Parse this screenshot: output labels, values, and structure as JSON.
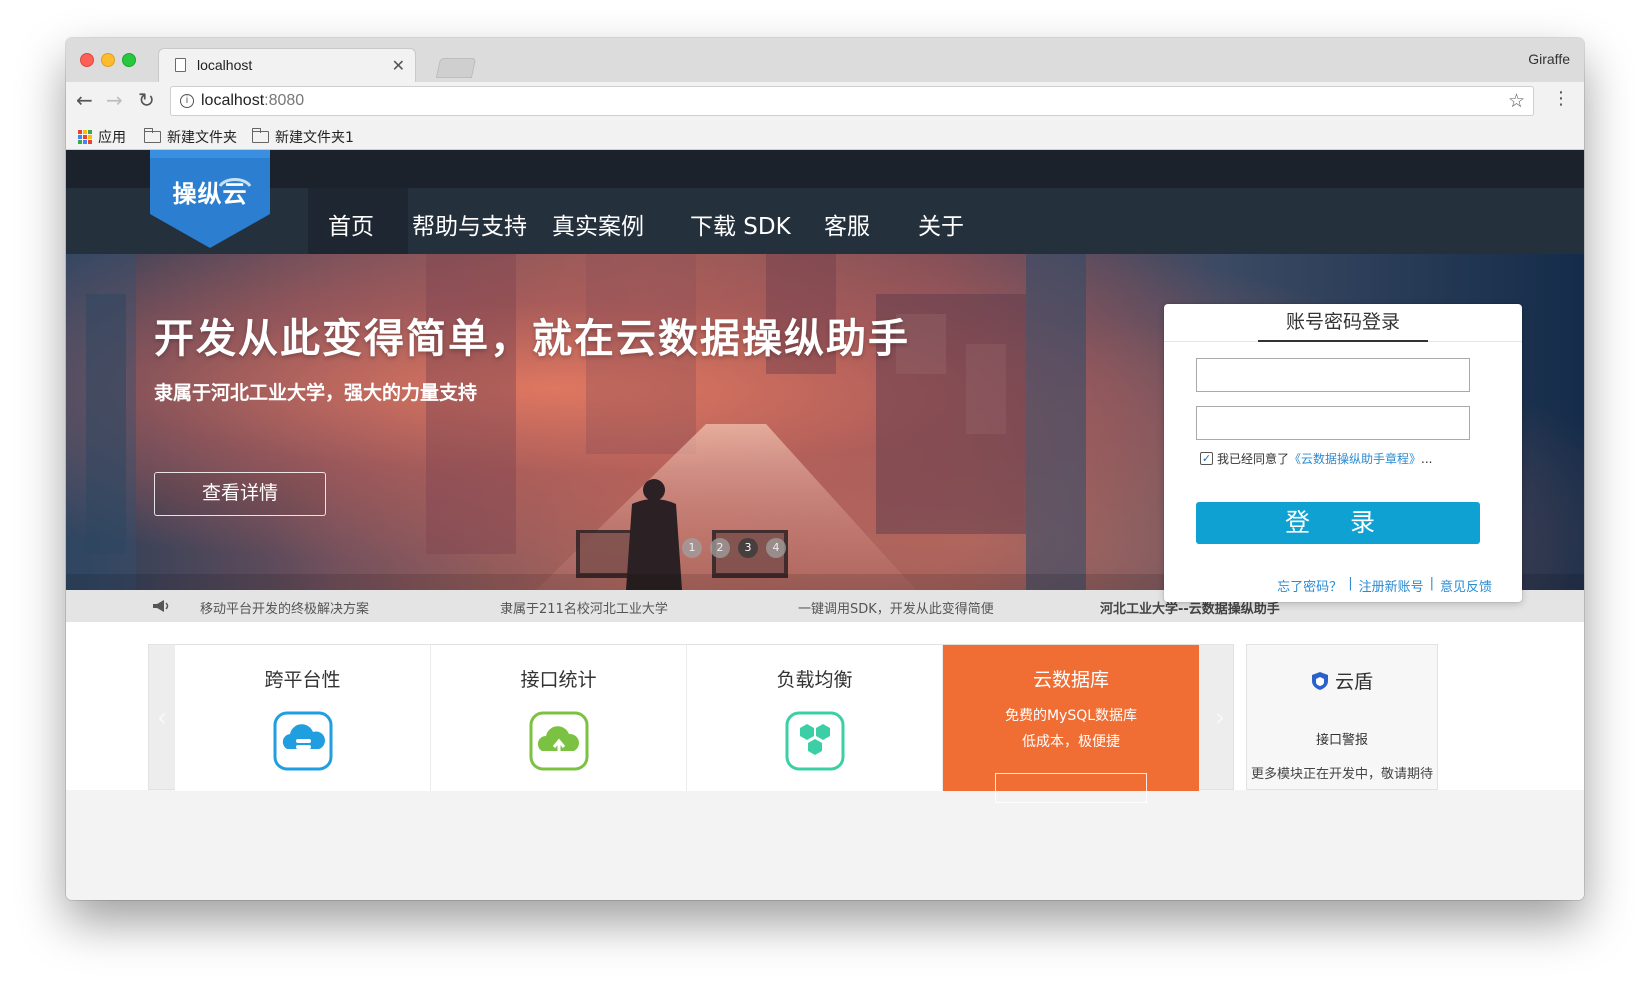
{
  "browser": {
    "tab_title": "localhost",
    "profile_name": "Giraffe",
    "url_host": "localhost",
    "url_port": ":8080",
    "bookmarks": [
      "应用",
      "新建文件夹",
      "新建文件夹1"
    ]
  },
  "site": {
    "logo_text": "操纵云",
    "nav": [
      "首页",
      "帮助与支持",
      "真实案例",
      "下载 SDK",
      "客服",
      "关于"
    ]
  },
  "hero": {
    "headline": "开发从此变得简单，就在云数据操纵助手",
    "subtitle": "隶属于河北工业大学，强大的力量支持",
    "details_button": "查看详情",
    "dots": [
      "1",
      "2",
      "3",
      "4"
    ],
    "active_dot": 3
  },
  "login": {
    "tab_label": "账号密码登录",
    "agree_prefix": "我已经同意了",
    "agree_link": "《云数据操纵助手章程》",
    "agree_suffix": "...",
    "submit_label": "登 录",
    "forgot": "忘了密码？",
    "register": "注册新账号",
    "feedback": "意见反馈",
    "separator": "|"
  },
  "ticker": [
    "移动平台开发的终极解决方案",
    "隶属于211名校河北工业大学",
    "一键调用SDK，开发从此变得简便",
    "河北工业大学--云数据操纵助手"
  ],
  "features": {
    "left_arrow": "‹",
    "right_arrow": "›",
    "cards": [
      {
        "title": "跨平台性",
        "icon": "cloud-database-icon",
        "color": "#1f9ee0"
      },
      {
        "title": "接口统计",
        "icon": "cloud-upload-icon",
        "color": "#7cc242"
      },
      {
        "title": "负载均衡",
        "icon": "hexagons-icon",
        "color": "#3ccfa6"
      }
    ],
    "highlight": {
      "title": "云数据库",
      "line1": "免费的MySQL数据库",
      "line2": "低成本，极便捷",
      "color": "#f06e33"
    },
    "side": {
      "title": "云盾",
      "line1": "接口警报",
      "line2": "更多模块正在开发中，敬请期待"
    }
  },
  "colors": {
    "nav_bg": "#25303d",
    "login_button": "#0ea1d2",
    "link": "#2a8bd2",
    "highlight_card": "#f06e33"
  }
}
